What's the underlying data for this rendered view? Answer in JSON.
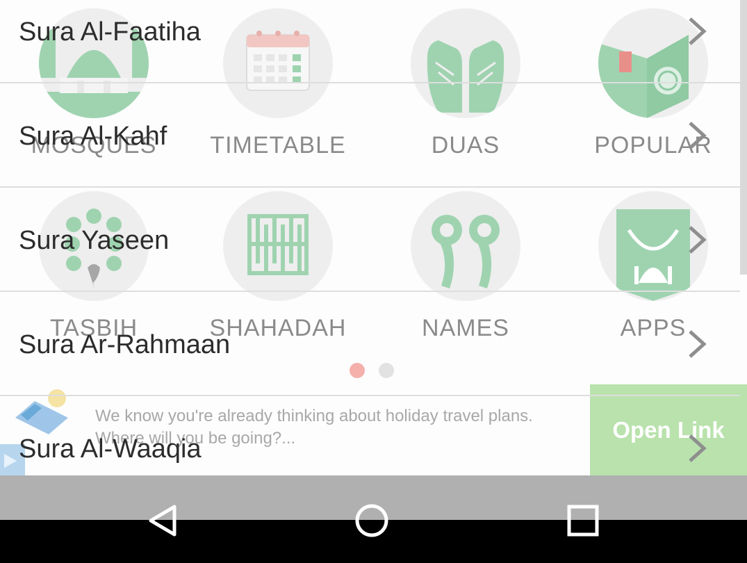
{
  "home_grid": {
    "tiles": [
      {
        "label": "MOSQUES",
        "icon": "mosque-icon"
      },
      {
        "label": "TIMETABLE",
        "icon": "calendar-icon"
      },
      {
        "label": "DUAS",
        "icon": "praying-hands-icon"
      },
      {
        "label": "POPULAR",
        "icon": "quran-book-icon"
      },
      {
        "label": "TASBIH",
        "icon": "tasbih-beads-icon"
      },
      {
        "label": "SHAHADAH",
        "icon": "calligraphy-icon"
      },
      {
        "label": "NAMES",
        "icon": "ninety-nine-icon"
      },
      {
        "label": "APPS",
        "icon": "apps-mosque-icon"
      }
    ],
    "page_indicator": {
      "count": 2,
      "active_index": 0
    }
  },
  "sura_list": {
    "items": [
      {
        "label": "Sura Al-Faatiha"
      },
      {
        "label": "Sura Al-Kahf"
      },
      {
        "label": "Sura Yaseen"
      },
      {
        "label": "Sura Ar-Rahmaan"
      },
      {
        "label": "Sura Al-Waaqia"
      }
    ]
  },
  "ad": {
    "text": "We know you're already thinking about holiday travel plans. Where will you be going?...",
    "button_label": "Open Link"
  },
  "colors": {
    "accent_green": "#8fcaa3",
    "ad_button": "#b9e2ad",
    "page_dot_active": "#f5b0ab",
    "page_dot_inactive": "#e2e2e2"
  },
  "navigation": {
    "buttons": [
      "back-icon",
      "home-icon",
      "recents-icon"
    ]
  }
}
